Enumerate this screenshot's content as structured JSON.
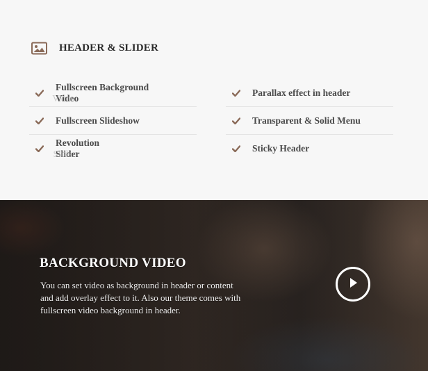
{
  "header_section": {
    "title": "HEADER & SLIDER",
    "icon": "image-icon"
  },
  "features": {
    "left": [
      {
        "label": "Fullscreen Background Video",
        "ghost": "Video",
        "icon": "check-icon"
      },
      {
        "label": "Fullscreen Slideshow",
        "icon": "check-icon"
      },
      {
        "label": "Revolution Slider",
        "ghost": "Slider",
        "icon": "check-icon"
      }
    ],
    "right": [
      {
        "label": "Parallax effect in header",
        "icon": "check-icon"
      },
      {
        "label": "Transparent & Solid Menu",
        "icon": "check-icon"
      },
      {
        "label": "Sticky Header",
        "icon": "check-icon"
      }
    ]
  },
  "hero": {
    "title": "BACKGROUND VIDEO",
    "line1": "You can set video as background in header or content",
    "line2": "and add overlay effect to it. Also our theme comes with",
    "line3": "fullscreen video background in header.",
    "play_icon": "play-icon"
  },
  "colors": {
    "accent": "#8a6a58",
    "text_dark": "#2a2a2a",
    "text_feature": "#4a4a4a",
    "hero_text": "#ffffff"
  }
}
